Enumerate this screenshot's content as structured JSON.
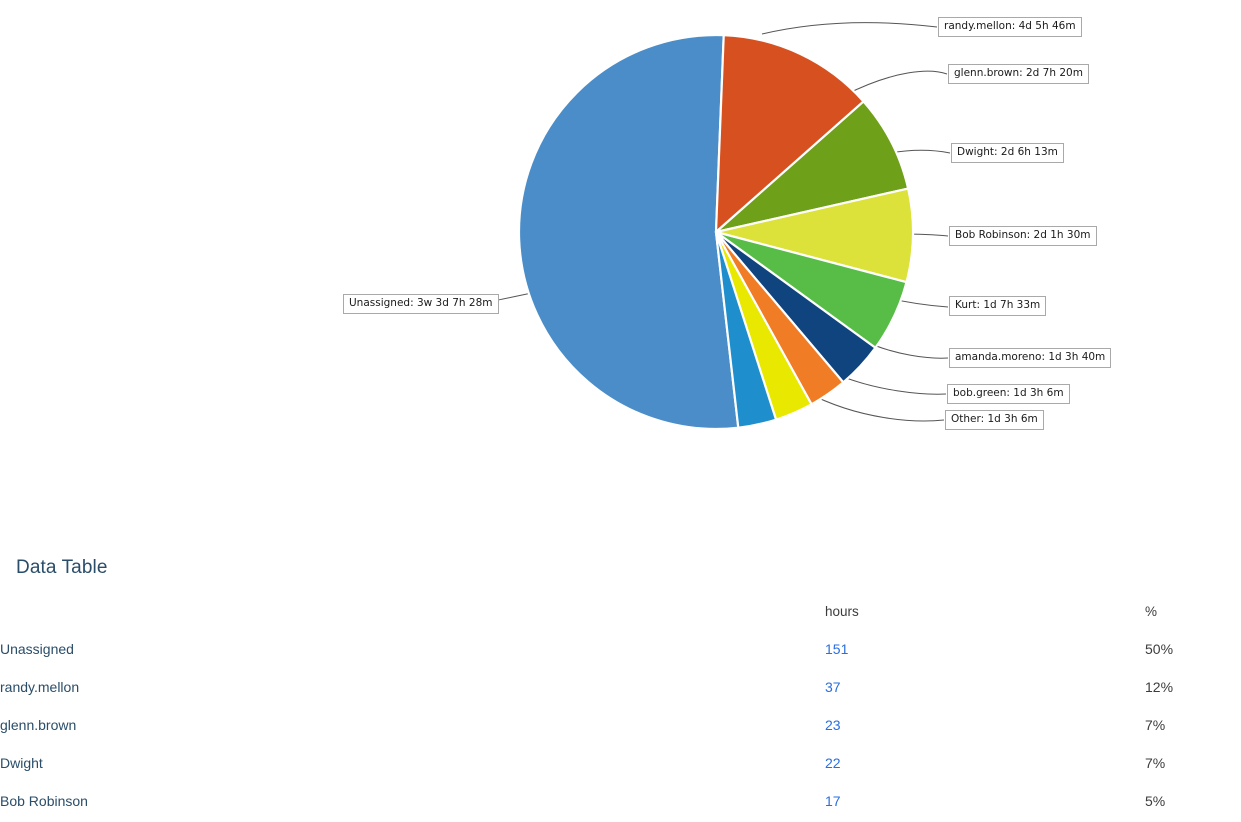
{
  "chart_data": {
    "type": "pie",
    "title": "",
    "legend_position": "callout-labels",
    "value_unit": "hours",
    "categories": [
      "Unassigned",
      "randy.mellon",
      "glenn.brown",
      "Dwight",
      "Bob Robinson",
      "Kurt",
      "amanda.moreno",
      "bob.green",
      "Other"
    ],
    "values": [
      151,
      37,
      23,
      22,
      17,
      11,
      9,
      9,
      9
    ],
    "percents": [
      50,
      12,
      7,
      7,
      5,
      4,
      3,
      3,
      3
    ],
    "duration_labels": [
      "3w 3d 7h 28m",
      "4d 5h 46m",
      "2d 7h 20m",
      "2d 6h 13m",
      "2d 1h 30m",
      "1d 7h 33m",
      "1d 3h 40m",
      "1d 3h 6m",
      "1d 3h 6m"
    ],
    "colors": [
      "#4a8dc8",
      "#d6511f",
      "#6fa019",
      "#dce23a",
      "#58bd46",
      "#10447e",
      "#f07d26",
      "#e8e800",
      "#1f8ecd"
    ]
  },
  "callouts": [
    {
      "text": "randy.mellon: 4d 5h 46m",
      "name": "callout-randy-mellon"
    },
    {
      "text": "glenn.brown: 2d 7h 20m",
      "name": "callout-glenn-brown"
    },
    {
      "text": "Dwight: 2d 6h 13m",
      "name": "callout-dwight"
    },
    {
      "text": "Bob Robinson: 2d 1h 30m",
      "name": "callout-bob-robinson"
    },
    {
      "text": "Kurt: 1d 7h 33m",
      "name": "callout-kurt"
    },
    {
      "text": "amanda.moreno: 1d 3h 40m",
      "name": "callout-amanda-moreno"
    },
    {
      "text": "bob.green: 1d 3h 6m",
      "name": "callout-bob-green"
    },
    {
      "text": "Other: 1d 3h 6m",
      "name": "callout-other"
    },
    {
      "text": "Unassigned: 3w 3d 7h 28m",
      "name": "callout-unassigned"
    }
  ],
  "table": {
    "title": "Data Table",
    "headers": {
      "name": "",
      "hours": "hours",
      "percent": "%"
    },
    "rows": [
      {
        "name": "Unassigned",
        "hours": "151",
        "percent": "50%"
      },
      {
        "name": "randy.mellon",
        "hours": "37",
        "percent": "12%"
      },
      {
        "name": "glenn.brown",
        "hours": "23",
        "percent": "7%"
      },
      {
        "name": "Dwight",
        "hours": "22",
        "percent": "7%"
      },
      {
        "name": "Bob Robinson",
        "hours": "17",
        "percent": "5%"
      }
    ]
  }
}
